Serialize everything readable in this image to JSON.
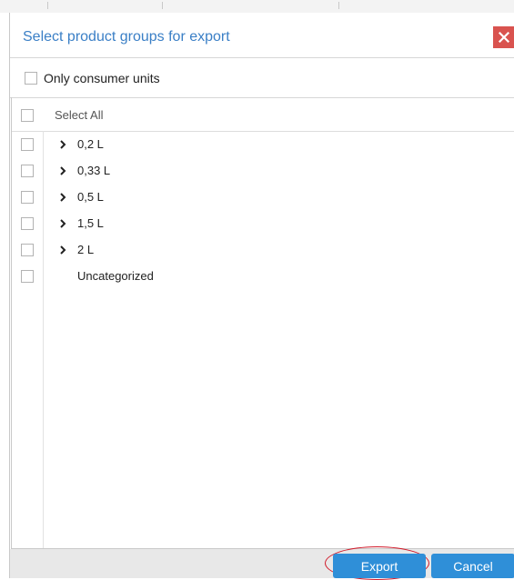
{
  "dialog": {
    "title": "Select product groups for export",
    "close_icon": "close-icon",
    "accent_color": "#3a7fc6",
    "close_color": "#d9534f"
  },
  "options": {
    "only_consumer_units_label": "Only consumer units",
    "only_consumer_units_checked": false
  },
  "tree": {
    "select_all_label": "Select All",
    "items": [
      {
        "label": "0,2 L",
        "expandable": true,
        "checked": false
      },
      {
        "label": "0,33 L",
        "expandable": true,
        "checked": false
      },
      {
        "label": "0,5 L",
        "expandable": true,
        "checked": false
      },
      {
        "label": "1,5 L",
        "expandable": true,
        "checked": false
      },
      {
        "label": "2 L",
        "expandable": true,
        "checked": false
      },
      {
        "label": "Uncategorized",
        "expandable": false,
        "checked": false
      }
    ]
  },
  "footer": {
    "export_label": "Export",
    "cancel_label": "Cancel",
    "button_color": "#2f8fd8",
    "highlight_color": "#d11a2a"
  }
}
